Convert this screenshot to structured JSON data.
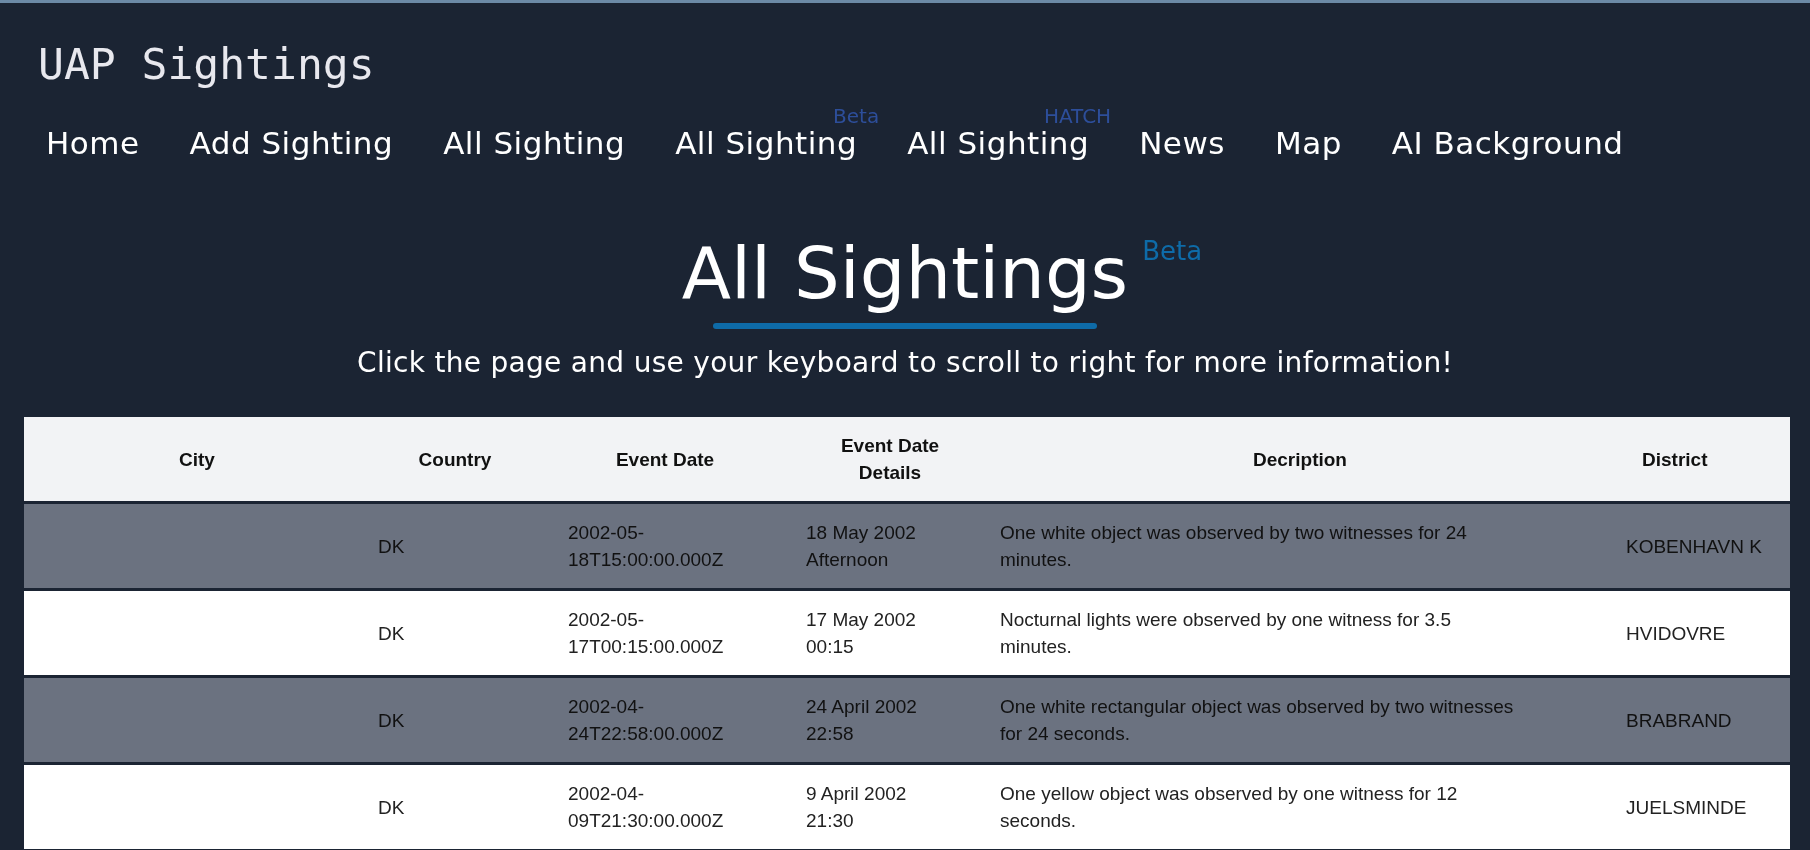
{
  "site_title": "UAP Sightings",
  "nav": [
    {
      "label": "Home"
    },
    {
      "label": "Add Sighting"
    },
    {
      "label": "All Sighting"
    },
    {
      "label": "All Sighting",
      "badge": "Beta"
    },
    {
      "label": "All Sighting",
      "badge": "HATCH"
    },
    {
      "label": "News"
    },
    {
      "label": "Map"
    },
    {
      "label": "AI Background"
    }
  ],
  "heading": {
    "title": "All Sightings",
    "badge": "Beta"
  },
  "hint": "Click the page and use your keyboard to scroll to right for more information!",
  "table": {
    "columns": [
      "City",
      "Country",
      "Event Date",
      "Event Date Details",
      "Decription",
      "District"
    ],
    "rows": [
      [
        "",
        "DK",
        "2002-05-18T15:00:00.000Z",
        "18 May 2002 Afternoon",
        "One white object was observed by two witnesses for 24 minutes.",
        "KOBENHAVN K"
      ],
      [
        "",
        "DK",
        "2002-05-17T00:15:00.000Z",
        "17 May 2002 00:15",
        "Nocturnal lights were observed by one witness for 3.5 minutes.",
        "HVIDOVRE"
      ],
      [
        "",
        "DK",
        "2002-04-24T22:58:00.000Z",
        "24 April 2002 22:58",
        "One white rectangular object was observed by two witnesses for 24 seconds.",
        "BRABRAND"
      ],
      [
        "",
        "DK",
        "2002-04-09T21:30:00.000Z",
        "9 April 2002 21:30",
        "One yellow object was observed by one witness for 12 seconds.",
        "JUELSMINDE"
      ]
    ]
  }
}
